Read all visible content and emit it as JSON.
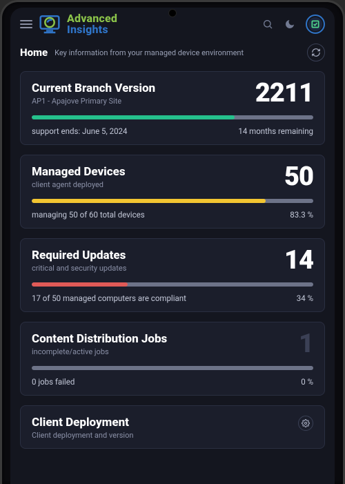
{
  "brand": {
    "line1": "Advanced",
    "line2": "Insights"
  },
  "page": {
    "title": "Home",
    "subtitle": "Key information from your managed device environment"
  },
  "cards": {
    "branch": {
      "title": "Current Branch Version",
      "subtitle": "AP1 - Apajove Primary Site",
      "value": "2211",
      "foot_left": "support ends: June 5, 2024",
      "foot_right": "14 months remaining",
      "progress_percent": 72,
      "progress_color": "#25c18c"
    },
    "devices": {
      "title": "Managed Devices",
      "subtitle": "client agent deployed",
      "value": "50",
      "foot_left": "managing 50 of 60 total devices",
      "foot_right": "83.3 %",
      "progress_percent": 83,
      "progress_color": "#f2c531"
    },
    "updates": {
      "title": "Required Updates",
      "subtitle": "critical and security updates",
      "value": "14",
      "foot_left": "17 of 50 managed computers are compliant",
      "foot_right": "34 %",
      "progress_percent": 34,
      "progress_color": "#e05a57"
    },
    "jobs": {
      "title": "Content Distribution Jobs",
      "subtitle": "incomplete/active jobs",
      "value": "1",
      "value_dim": true,
      "foot_left": "0 jobs failed",
      "foot_right": "0 %",
      "progress_percent": 0,
      "progress_color": "#6d7388"
    },
    "deploy": {
      "title": "Client Deployment",
      "subtitle": "Client deployment and version"
    }
  }
}
